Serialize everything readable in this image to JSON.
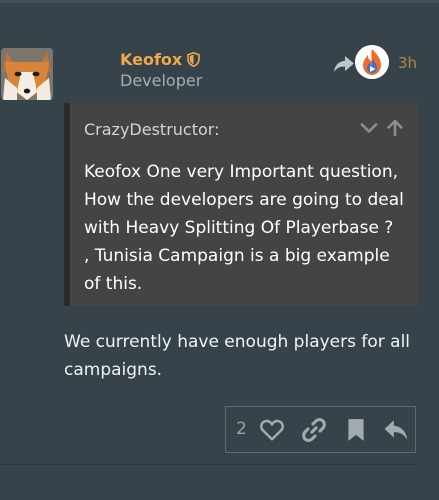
{
  "post": {
    "author": "Keofox",
    "author_title": "Developer",
    "time": "3h",
    "badge_icon": "shield-icon",
    "quote": {
      "author": "CrazyDestructor:",
      "text": "Keofox One very Important question, How the developers are going to deal with Heavy Splitting Of Playerbase ? , Tunisia Campaign is a big example of this."
    },
    "body": "We currently have enough players for all campaigns.",
    "like_count": "2"
  },
  "icons": {
    "avatar": "fox-avatar",
    "share": "share-arrow-icon",
    "app": "app-badge-icon",
    "expand": "chevron-down-icon",
    "go_to_quote": "arrow-up-icon",
    "like": "heart-icon",
    "link": "link-icon",
    "bookmark": "bookmark-icon",
    "reply": "reply-icon"
  },
  "colors": {
    "background": "#36434a",
    "username": "#f0a84c",
    "quote_bg": "#444444",
    "text": "#f2f2f2"
  }
}
